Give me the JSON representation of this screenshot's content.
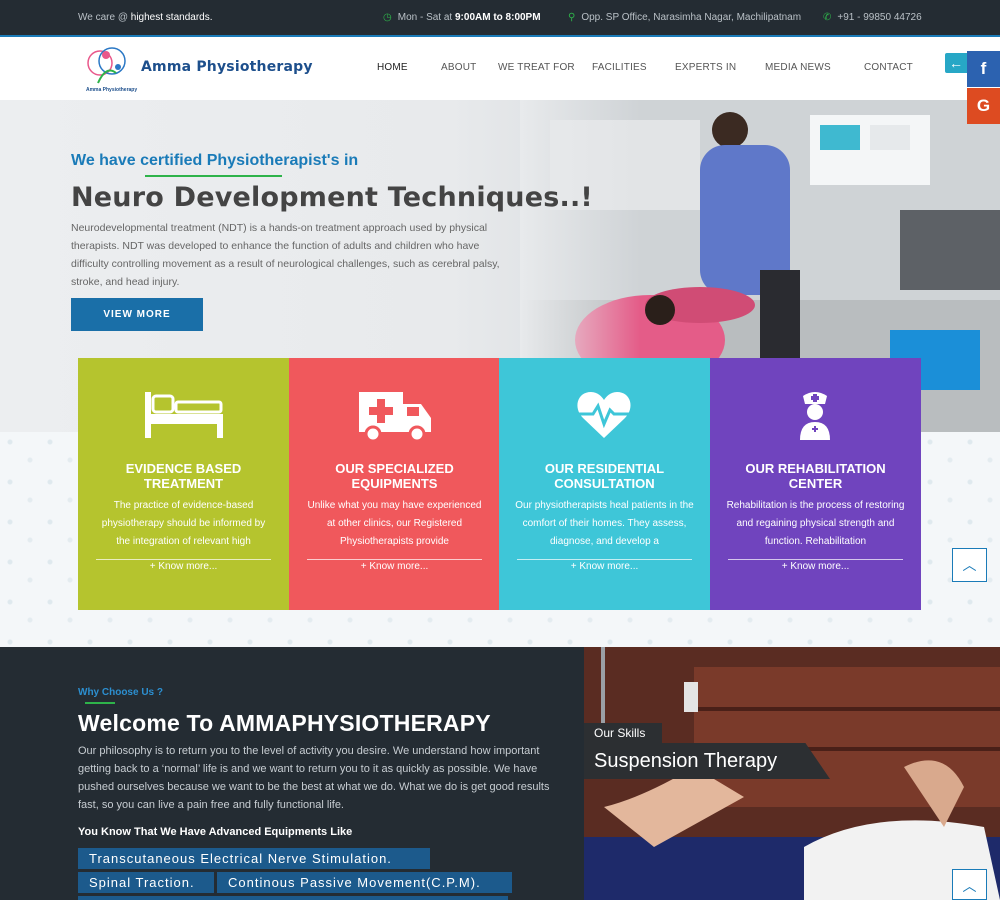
{
  "topbar": {
    "tagline_prefix": "We care @ ",
    "tagline_highlight": "highest standards.",
    "hours_prefix": "Mon - Sat at ",
    "hours_value": "9:00AM to 8:00PM",
    "address": "Opp. SP Office, Narasimha Nagar, Machilipatnam",
    "phone": "+91 - 99850 44726"
  },
  "brand": {
    "name": "Amma Physiotherapy",
    "logo_caption": "Amma Physiotherapy"
  },
  "nav": [
    "HOME",
    "ABOUT",
    "WE TREAT FOR",
    "FACILITIES",
    "EXPERTS IN",
    "MEDIA NEWS",
    "CONTACT"
  ],
  "social": {
    "facebook": "f",
    "google": "G"
  },
  "hero": {
    "subtitle": "We have certified Physiotherapist's in",
    "title": "Neuro Development Techniques..!",
    "text": "Neurodevelopmental treatment (NDT) is a hands-on treatment approach used by physical therapists. NDT was developed to enhance the function of adults and children who have difficulty controlling movement as a result of neurological challenges, such as cerebral palsy, stroke, and head injury.",
    "button": "VIEW MORE"
  },
  "cards": [
    {
      "icon": "hospital-bed-icon",
      "title": "EVIDENCE BASED TREATMENT",
      "text": "The practice of evidence-based physiotherapy should be informed by the integration of relevant high",
      "more": "+ Know more...",
      "color": "#b5c42e"
    },
    {
      "icon": "ambulance-icon",
      "title": "OUR SPECIALIZED EQUIPMENTS",
      "text": "Unlike what you may have experienced at other clinics, our Registered Physiotherapists provide",
      "more": "+ Know more...",
      "color": "#f0585c"
    },
    {
      "icon": "heartbeat-icon",
      "title": "OUR RESIDENTIAL CONSULTATION",
      "text": "Our physiotherapists heal patients in the comfort of their homes. They assess, diagnose, and develop a",
      "more": "+ Know more...",
      "color": "#3ec6d8"
    },
    {
      "icon": "nurse-icon",
      "title": "OUR REHABILITATION CENTER",
      "text": "Rehabilitation is the process of restoring and regaining physical strength and function. Rehabilitation",
      "more": "+ Know more...",
      "color": "#7044be"
    }
  ],
  "why": {
    "eyebrow": "Why Choose Us ?",
    "title": "Welcome To AMMAPHYSIOTHERAPY",
    "text": "Our philosophy is to return you to the level of activity you desire. We understand how important getting back to a ‘normal’ life is and we want to return you to it as quickly as possible. We have pushed ourselves because we want to be the best at what we do. What we do is get good results fast, so you can live a pain free and fully functional life.",
    "equipment_heading": "You Know That We Have Advanced Equipments Like",
    "equipments": [
      "Transcutaneous Electrical Nerve Stimulation.",
      "Spinal Traction.",
      "Continous Passive Movement(C.P.M)."
    ]
  },
  "skills": {
    "label": "Our Skills",
    "title": "Suspension Therapy"
  }
}
